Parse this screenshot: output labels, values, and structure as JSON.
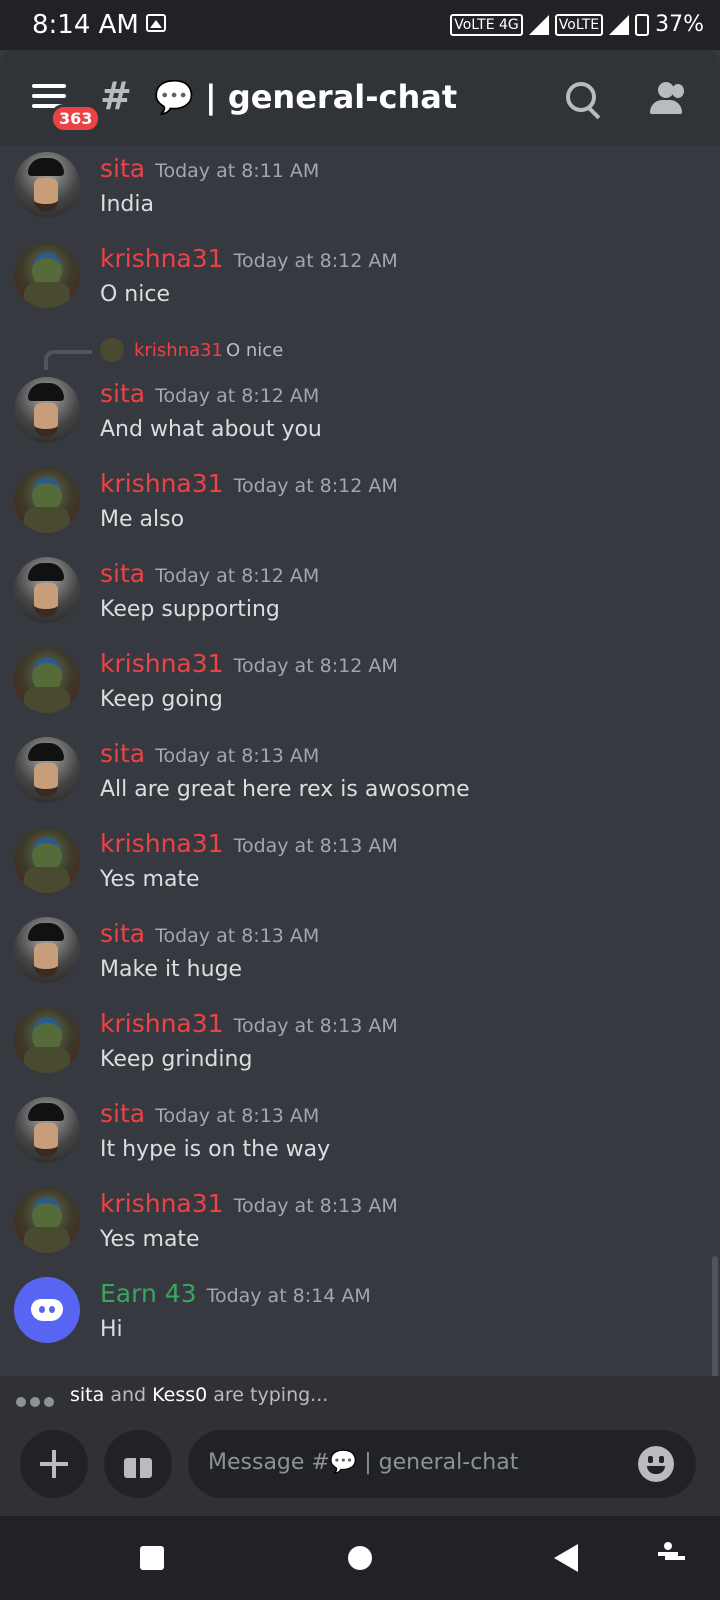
{
  "status_bar": {
    "time": "8:14 AM",
    "network": "VoLTE 4G",
    "network2": "VoLTE",
    "battery": "37%"
  },
  "header": {
    "unread_badge": "363",
    "channel_name": "general-chat",
    "channel_emoji": "💬"
  },
  "messages": [
    {
      "author": "sita",
      "time": "Today at 8:11 AM",
      "text": "India"
    },
    {
      "author": "krishna31",
      "time": "Today at 8:12 AM",
      "text": "O nice"
    },
    {
      "author": "sita",
      "time": "Today at 8:12 AM",
      "text": "And what about you",
      "reply_to": {
        "author": "krishna31",
        "text": "O nice"
      }
    },
    {
      "author": "krishna31",
      "time": "Today at 8:12 AM",
      "text": "Me also"
    },
    {
      "author": "sita",
      "time": "Today at 8:12 AM",
      "text": "Keep supporting"
    },
    {
      "author": "krishna31",
      "time": "Today at 8:12 AM",
      "text": "Keep going"
    },
    {
      "author": "sita",
      "time": "Today at 8:13 AM",
      "text": "All are great here rex is awosome"
    },
    {
      "author": "krishna31",
      "time": "Today at 8:13 AM",
      "text": "Yes mate"
    },
    {
      "author": "sita",
      "time": "Today at 8:13 AM",
      "text": "Make it huge"
    },
    {
      "author": "krishna31",
      "time": "Today at 8:13 AM",
      "text": "Keep grinding"
    },
    {
      "author": "sita",
      "time": "Today at 8:13 AM",
      "text": "It hype is on the way"
    },
    {
      "author": "krishna31",
      "time": "Today at 8:13 AM",
      "text": "Yes mate"
    },
    {
      "author": "Earn 43",
      "time": "Today at 8:14 AM",
      "text": "Hi"
    }
  ],
  "typing": {
    "user1": "sita",
    "and": "and",
    "user2": "Kess0",
    "suffix": "are typing..."
  },
  "composer": {
    "placeholder": "Message #💬 | general-chat"
  },
  "colors": {
    "accent_red": "#ed4245",
    "accent_green": "#3ba55d",
    "discord_blurple": "#5865f2"
  }
}
